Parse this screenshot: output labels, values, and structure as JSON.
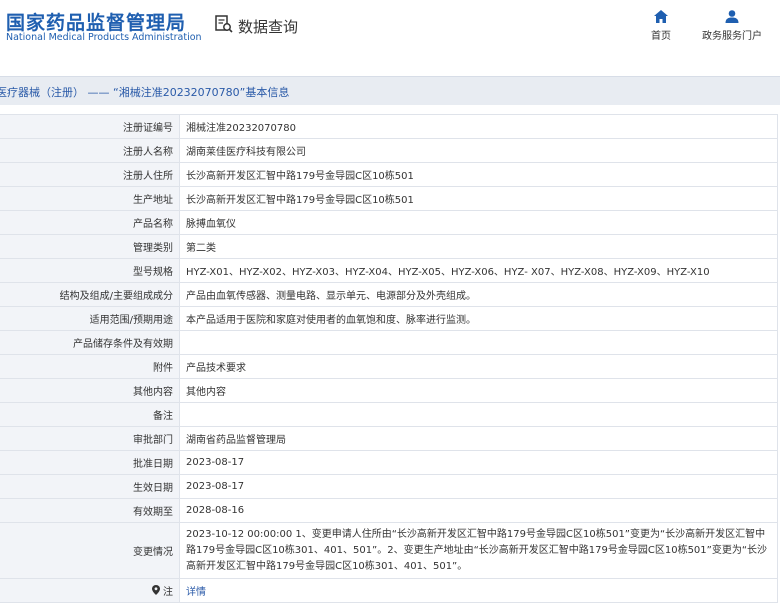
{
  "header": {
    "site_name_cn": "国家药品监督管理局",
    "site_name_en": "National Medical Products Administration",
    "query_label": "数据查询",
    "nav": [
      {
        "label": "首页",
        "icon": "home-icon"
      },
      {
        "label": "政务服务门户",
        "icon": "user-icon"
      }
    ]
  },
  "breadcrumb": "医疗器械（注册） —— “湘械注准20232070780”基本信息",
  "colors": {
    "brand_blue": "#1f5fb0",
    "label_bg": "#f2f4f8",
    "bar_bg": "#e8ecf2",
    "border": "#dfe3ea"
  },
  "rows": [
    {
      "label": "注册证编号",
      "value": "湘械注准20232070780"
    },
    {
      "label": "注册人名称",
      "value": "湖南莱佳医疗科技有限公司"
    },
    {
      "label": "注册人住所",
      "value": "长沙高新开发区汇智中路179号金导园C区10栋501"
    },
    {
      "label": "生产地址",
      "value": "长沙高新开发区汇智中路179号金导园C区10栋501"
    },
    {
      "label": "产品名称",
      "value": "脉搏血氧仪"
    },
    {
      "label": "管理类别",
      "value": "第二类"
    },
    {
      "label": "型号规格",
      "value": "HYZ-X01、HYZ-X02、HYZ-X03、HYZ-X04、HYZ-X05、HYZ-X06、HYZ- X07、HYZ-X08、HYZ-X09、HYZ-X10"
    },
    {
      "label": "结构及组成/主要组成成分",
      "value": "产品由血氧传感器、测量电路、显示单元、电源部分及外壳组成。"
    },
    {
      "label": "适用范围/预期用途",
      "value": "本产品适用于医院和家庭对使用者的血氧饱和度、脉率进行监测。"
    },
    {
      "label": "产品储存条件及有效期",
      "value": ""
    },
    {
      "label": "附件",
      "value": "产品技术要求"
    },
    {
      "label": "其他内容",
      "value": "其他内容"
    },
    {
      "label": "备注",
      "value": ""
    },
    {
      "label": "审批部门",
      "value": "湖南省药品监督管理局"
    },
    {
      "label": "批准日期",
      "value": "2023-08-17"
    },
    {
      "label": "生效日期",
      "value": "2023-08-17"
    },
    {
      "label": "有效期至",
      "value": "2028-08-16"
    },
    {
      "label": "变更情况",
      "value": "2023-10-12 00:00:00 1、变更申请人住所由“长沙高新开发区汇智中路179号金导园C区10栋501”变更为“长沙高新开发区汇智中路179号金导园C区10栋301、401、501”。2、变更生产地址由“长沙高新开发区汇智中路179号金导园C区10栋501”变更为“长沙高新开发区汇智中路179号金导园C区10栋301、401、501”。"
    },
    {
      "label": "注",
      "value": "详情",
      "icon": "location-icon"
    }
  ]
}
